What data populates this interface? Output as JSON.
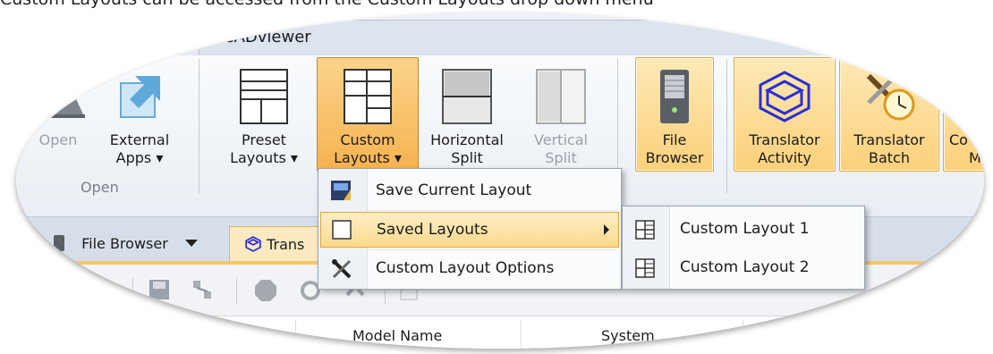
{
  "caption": "Custom Layouts can be accessed from the Custom Layouts drop down menu",
  "app": {
    "title": "CADviewer"
  },
  "ribbon": {
    "open": {
      "label": "Open"
    },
    "external_apps": {
      "label_line1": "External",
      "label_line2": "Apps ▾"
    },
    "open_group_label": "Open",
    "preset_layouts": {
      "label_line1": "Preset",
      "label_line2": "Layouts ▾"
    },
    "custom_layouts": {
      "label_line1": "Custom",
      "label_line2": "Layouts ▾"
    },
    "horizontal_split": {
      "label_line1": "Horizontal",
      "label_line2": "Split"
    },
    "vertical_split": {
      "label_line1": "Vertical",
      "label_line2": "Split"
    },
    "file_browser": {
      "label_line1": "File",
      "label_line2": "Browser"
    },
    "translator_activity": {
      "label_line1": "Translator",
      "label_line2": "Activity"
    },
    "translator_batch": {
      "label_line1": "Translator",
      "label_line2": "Batch"
    },
    "partial_next": {
      "label_line1": "Co",
      "label_line2": "M"
    }
  },
  "tabs": {
    "file_browser": "File Browser",
    "translator": "Trans"
  },
  "menu": {
    "items": [
      {
        "label": "Save Current Layout"
      },
      {
        "label": "Saved Layouts"
      },
      {
        "label": "Custom Layout Options"
      }
    ]
  },
  "submenu": {
    "items": [
      {
        "label": "Custom Layout 1"
      },
      {
        "label": "Custom Layout 2"
      }
    ]
  },
  "grid": {
    "columns": [
      "Model Name",
      "System"
    ]
  },
  "colors": {
    "highlight": "#fbd07a",
    "accent_border": "#e2a74a",
    "ribbon_bg": "#e9eef4",
    "menu_bg": "#fafbfc"
  }
}
